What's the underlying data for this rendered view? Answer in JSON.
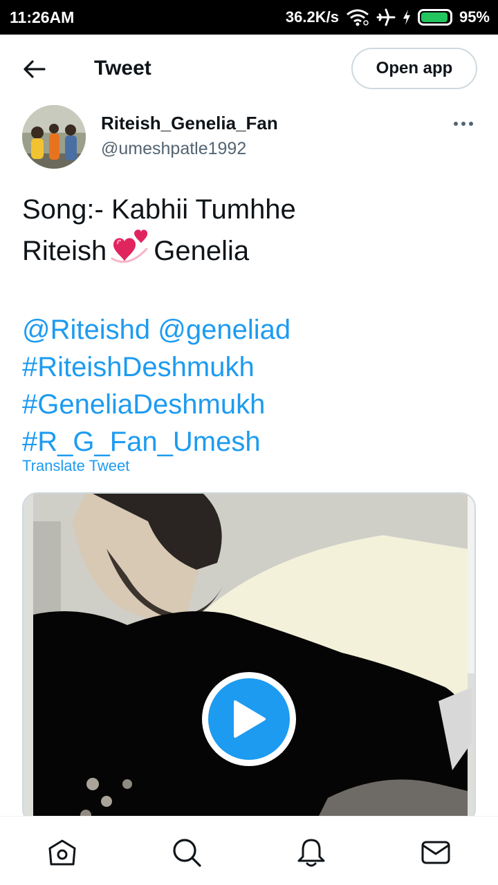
{
  "status_bar": {
    "time": "11:26AM",
    "speed": "36.2K/s",
    "battery_percent": "95%",
    "battery_level": 0.95,
    "icons": [
      "wifi-icon",
      "airplane-icon",
      "charging-bolt-icon",
      "battery-icon"
    ]
  },
  "header": {
    "title": "Tweet",
    "open_app_label": "Open app"
  },
  "author": {
    "name": "Riteish_Genelia_Fan",
    "handle": "@umeshpatle1992"
  },
  "tweet": {
    "line1": "Song:- Kabhii Tumhhe",
    "line2_before": "Riteish",
    "line2_after": "Genelia",
    "mention1": "@Riteishd",
    "mention2": "@geneliad",
    "hashtag1": "#RiteishDeshmukh",
    "hashtag2": "#GeneliaDeshmukh",
    "hashtag3": "#R_G_Fan_Umesh",
    "emoji": "two-hearts-icon"
  },
  "translate_label": "Translate Tweet",
  "media": {
    "type": "video",
    "play_icon": "play-icon"
  },
  "bottom_nav": [
    "home-icon",
    "search-icon",
    "notifications-icon",
    "messages-icon"
  ],
  "colors": {
    "accent": "#1d9bf0",
    "text": "#0f1419",
    "secondary_text": "#536471",
    "border": "#cfd9de",
    "battery": "#22c55e"
  }
}
